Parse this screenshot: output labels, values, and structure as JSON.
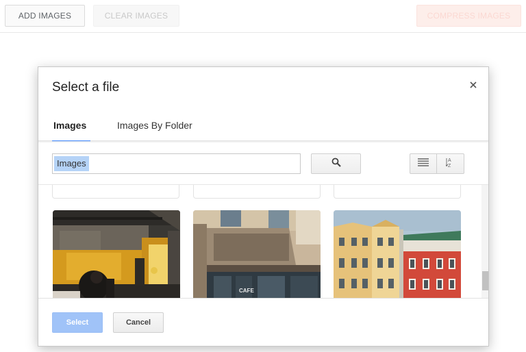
{
  "toolbar": {
    "add_images": "ADD IMAGES",
    "clear_images": "CLEAR IMAGES",
    "compress_images": "COMPRESS IMAGES"
  },
  "dialog": {
    "title": "Select a file",
    "close_icon": "close-icon",
    "tabs": [
      {
        "label": "Images",
        "active": true
      },
      {
        "label": "Images By Folder",
        "active": false
      }
    ],
    "search": {
      "value": "Images",
      "icon": "search-icon"
    },
    "view_buttons": [
      {
        "icon": "list-view-icon"
      },
      {
        "icon": "sort-az-icon"
      }
    ],
    "thumbnails": [
      {
        "icon": "photo-cafe-interior"
      },
      {
        "icon": "photo-building-cafe"
      },
      {
        "icon": "photo-colorful-houses"
      }
    ],
    "buttons": {
      "select": "Select",
      "cancel": "Cancel"
    },
    "colors": {
      "accent": "#4d90fe",
      "select_button": "#a0c3f8",
      "file_icon": "#db4437"
    }
  }
}
